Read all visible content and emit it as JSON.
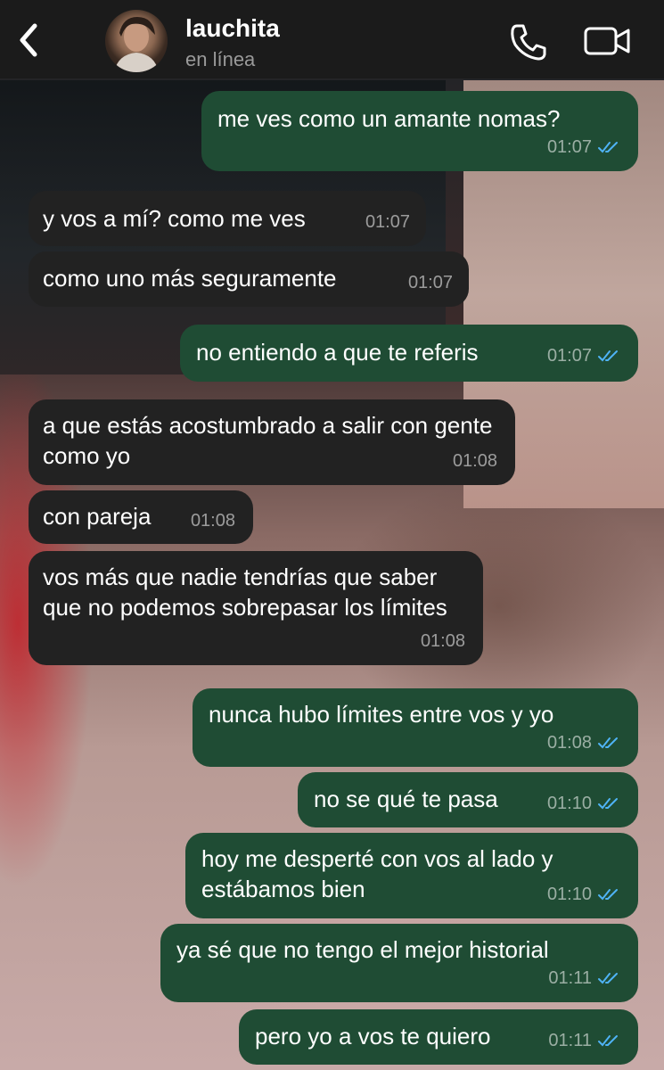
{
  "header": {
    "contact_name": "lauchita",
    "status": "en línea"
  },
  "colors": {
    "incoming_bubble": "#222222",
    "outgoing_bubble": "#1f4c34",
    "read_ticks": "#4fb3f6"
  },
  "messages": [
    {
      "direction": "out",
      "text": "me ves como un amante nomas?",
      "time": "01:07",
      "read": true
    },
    {
      "direction": "in",
      "text": "y vos a mí? como me ves",
      "time": "01:07"
    },
    {
      "direction": "in",
      "text": "como uno más seguramente",
      "time": "01:07"
    },
    {
      "direction": "out",
      "text": "no entiendo a que te referis",
      "time": "01:07",
      "read": true
    },
    {
      "direction": "in",
      "text": "a que estás acostumbrado a salir con gente como yo",
      "time": "01:08"
    },
    {
      "direction": "in",
      "text": "con pareja",
      "time": "01:08"
    },
    {
      "direction": "in",
      "text": "vos más que nadie tendrías que saber que no podemos sobrepasar los límites",
      "time": "01:08"
    },
    {
      "direction": "out",
      "text": "nunca hubo límites entre vos y yo",
      "time": "01:08",
      "read": true
    },
    {
      "direction": "out",
      "text": "no se qué te pasa",
      "time": "01:10",
      "read": true
    },
    {
      "direction": "out",
      "text": "hoy me desperté con vos al lado y estábamos bien",
      "time": "01:10",
      "read": true
    },
    {
      "direction": "out",
      "text": "ya sé que no tengo el mejor historial",
      "time": "01:11",
      "read": true
    },
    {
      "direction": "out",
      "text": "pero yo a vos te quiero",
      "time": "01:11",
      "read": true
    }
  ]
}
